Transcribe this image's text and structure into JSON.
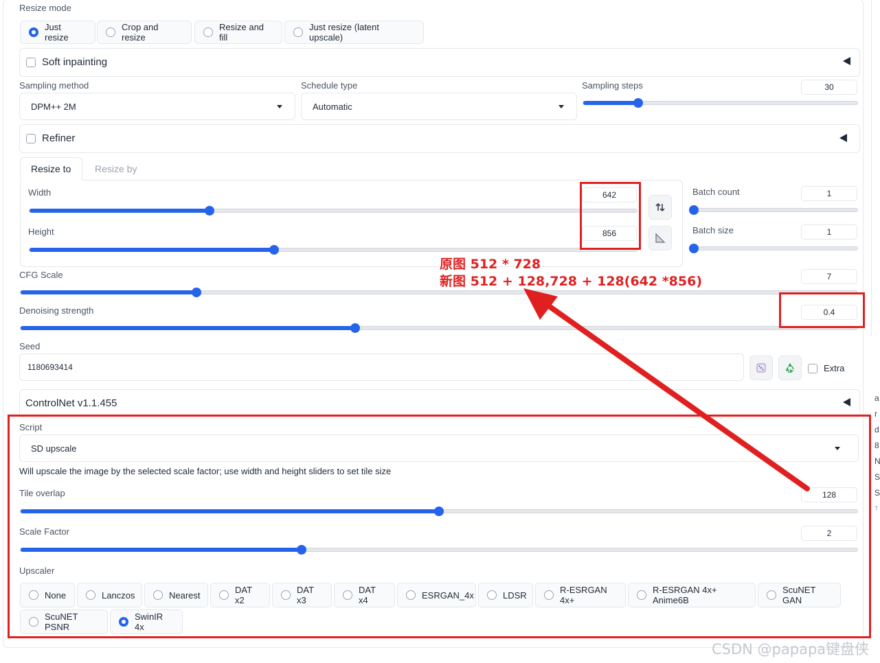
{
  "resize_mode": {
    "label": "Resize mode",
    "options": [
      "Just resize",
      "Crop and resize",
      "Resize and fill",
      "Just resize (latent upscale)"
    ],
    "selected": "Just resize"
  },
  "soft_inpainting": {
    "label": "Soft inpainting",
    "checked": false
  },
  "sampling_method": {
    "label": "Sampling method",
    "value": "DPM++ 2M"
  },
  "schedule_type": {
    "label": "Schedule type",
    "value": "Automatic"
  },
  "sampling_steps": {
    "label": "Sampling steps",
    "value": "30",
    "fraction": 0.2
  },
  "refiner": {
    "label": "Refiner",
    "checked": false
  },
  "tabs": [
    "Resize to",
    "Resize by"
  ],
  "width": {
    "label": "Width",
    "value": "642",
    "fraction": 0.296
  },
  "height": {
    "label": "Height",
    "value": "856",
    "fraction": 0.403
  },
  "batch_count": {
    "label": "Batch count",
    "value": "1",
    "fraction": 0
  },
  "batch_size": {
    "label": "Batch size",
    "value": "1",
    "fraction": 0
  },
  "cfg_scale": {
    "label": "CFG Scale",
    "value": "7",
    "fraction": 0.21
  },
  "denoising": {
    "label": "Denoising strength",
    "value": "0.4",
    "fraction": 0.4
  },
  "seed": {
    "label": "Seed",
    "value": "1180693414",
    "extra_label": "Extra"
  },
  "controlnet": {
    "label": "ControlNet v1.1.455"
  },
  "script": {
    "label": "Script",
    "value": "SD upscale",
    "description": "Will upscale the image by the selected scale factor; use width and height sliders to set tile size"
  },
  "tile_overlap": {
    "label": "Tile overlap",
    "value": "128",
    "fraction": 0.5
  },
  "scale_factor": {
    "label": "Scale Factor",
    "value": "2",
    "fraction": 0.336
  },
  "upscaler": {
    "label": "Upscaler",
    "options": [
      "None",
      "Lanczos",
      "Nearest",
      "DAT x2",
      "DAT x3",
      "DAT x4",
      "ESRGAN_4x",
      "LDSR",
      "R-ESRGAN 4x+",
      "R-ESRGAN 4x+ Anime6B",
      "ScuNET GAN",
      "ScuNET PSNR",
      "SwinIR 4x"
    ],
    "selected": "SwinIR 4x"
  },
  "annotation": {
    "line1": "原图 512 * 728",
    "line2": "新图 512 + 128,728 + 128(642 *856)",
    "color": "#e02020"
  },
  "watermark": "CSDN @papapa键盘侠",
  "right_edge_chars": [
    "a",
    "r",
    "d",
    "8",
    "N",
    "S",
    "S",
    "T"
  ],
  "colors": {
    "accent": "#2563eb",
    "annotation_red": "#e02020"
  }
}
